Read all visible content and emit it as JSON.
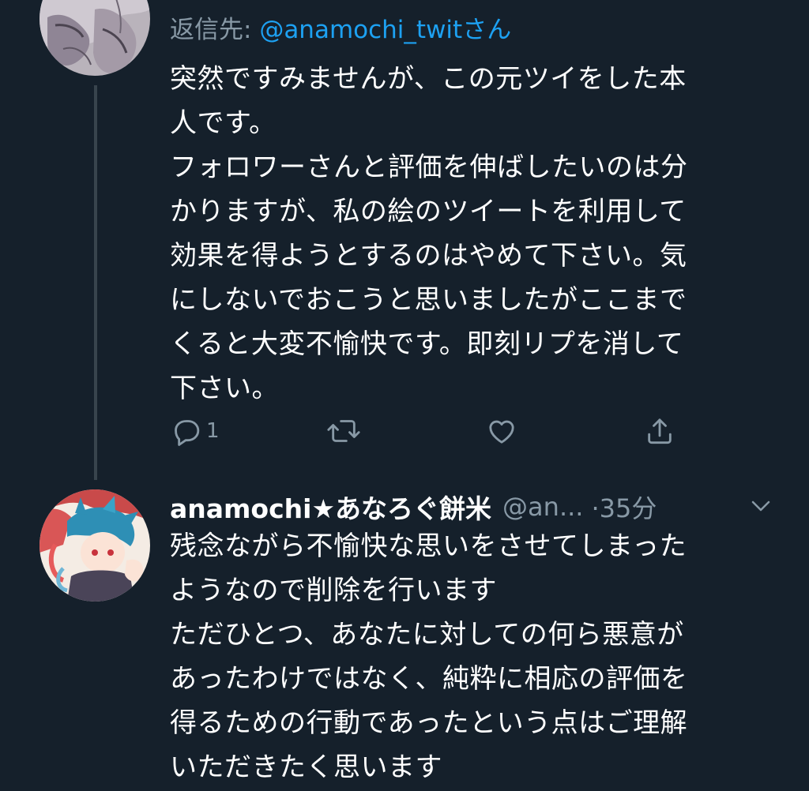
{
  "reply_context": {
    "prefix": "返信先: ",
    "handle": "@anamochi_twit",
    "suffix": "さん"
  },
  "tweet1": {
    "lines": [
      "突然ですみませんが、この元ツイをした本",
      "人です。",
      "フォロワーさんと評価を伸ばしたいのは分",
      "かりますが、私の絵のツイートを利用して",
      "効果を得ようとするのはやめて下さい。気",
      "にしないでおこうと思いましたがここまで",
      "くると大変不愉快です。即刻リプを消して",
      "下さい。"
    ],
    "actions": {
      "reply_icon": "reply-icon",
      "reply_count": "1",
      "retweet_icon": "retweet-icon",
      "like_icon": "heart-icon",
      "share_icon": "share-icon"
    }
  },
  "tweet2": {
    "display_name": "anamochi★あなろぐ餅米",
    "handle": "@an...",
    "time": "·35分",
    "menu_icon": "chevron-down-icon",
    "lines": [
      "残念ながら不愉快な思いをさせてしまった",
      "ようなので削除を行います",
      "ただひとつ、あなたに対しての何ら悪意が",
      "あったわけではなく、純粋に相応の評価を",
      "得るための行動であったという点はご理解",
      "いただきたく思います"
    ]
  },
  "colors": {
    "background": "#15202b",
    "text": "#ffffff",
    "secondary": "#8899a6",
    "accent": "#1da1f2",
    "thread_line": "#38444d"
  }
}
